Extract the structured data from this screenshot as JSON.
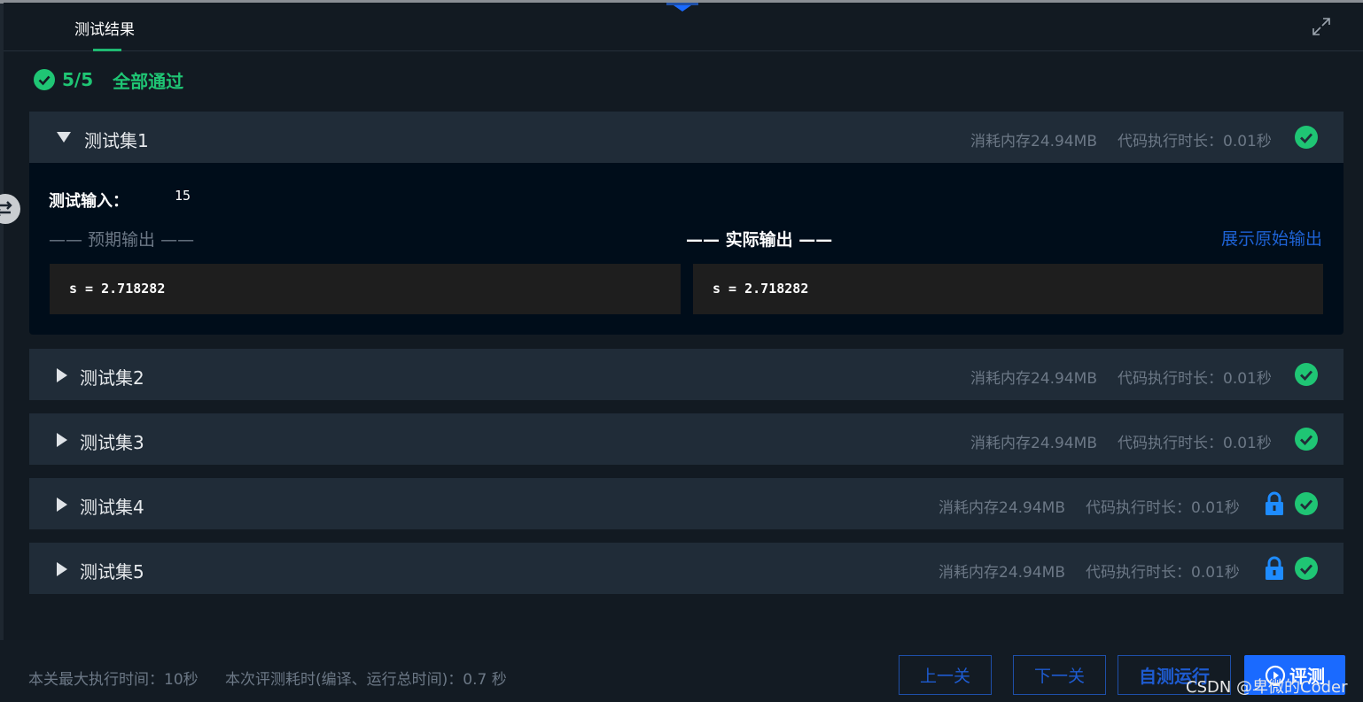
{
  "tabs": {
    "active": "测试结果"
  },
  "summary": {
    "count": "5/5",
    "status": "全部通过"
  },
  "sets": [
    {
      "title": "测试集1",
      "memory": "消耗内存24.94MB",
      "time": "代码执行时长：0.01秒",
      "expanded": true,
      "locked": false
    },
    {
      "title": "测试集2",
      "memory": "消耗内存24.94MB",
      "time": "代码执行时长：0.01秒",
      "expanded": false,
      "locked": false
    },
    {
      "title": "测试集3",
      "memory": "消耗内存24.94MB",
      "time": "代码执行时长：0.01秒",
      "expanded": false,
      "locked": false
    },
    {
      "title": "测试集4",
      "memory": "消耗内存24.94MB",
      "time": "代码执行时长：0.01秒",
      "expanded": false,
      "locked": true
    },
    {
      "title": "测试集5",
      "memory": "消耗内存24.94MB",
      "time": "代码执行时长：0.01秒",
      "expanded": false,
      "locked": true
    }
  ],
  "detail": {
    "input_label": "测试输入：",
    "input_value": "15",
    "expected_header": "—— 预期输出 ——",
    "actual_header": "—— 实际输出 ——",
    "raw_output_link": "展示原始输出",
    "expected_output": "s = 2.718282",
    "actual_output": "s = 2.718282"
  },
  "footer": {
    "max_time": "本关最大执行时间：10秒",
    "eval_time": "本次评测耗时(编译、运行总时间)：0.7 秒",
    "prev_label": "上一关",
    "next_label": "下一关",
    "self_test_label": "自测运行",
    "evaluate_label": "评测",
    "watermark": "CSDN @卑微的Coder"
  },
  "colors": {
    "success": "#1fc574",
    "accent_blue": "#1a6aff",
    "lock_blue": "#1e8cff"
  },
  "icons": [
    "check-circle-icon",
    "caret-down-icon",
    "caret-right-icon",
    "lock-icon",
    "expand-icon",
    "play-circle-icon",
    "swap-arrow-icon"
  ]
}
